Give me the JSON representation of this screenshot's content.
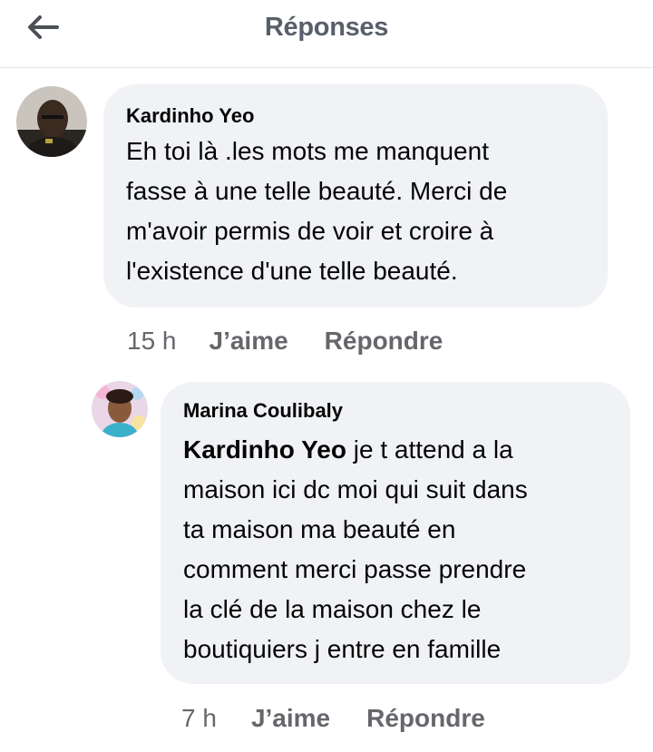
{
  "header": {
    "title": "Réponses",
    "back_icon": "arrow-left-icon"
  },
  "comments": [
    {
      "author": "Kardinho Yeo",
      "lines": [
        "Eh toi là .les mots me manquent",
        "fasse à une telle beauté. Merci de",
        "m'avoir permis de voir et croire à",
        "l'existence d'une telle beauté."
      ],
      "time": "15 h",
      "like_label": "J’aime",
      "reply_label": "Répondre"
    },
    {
      "author": "Marina Coulibaly",
      "mention": "Kardinho Yeo",
      "first_line_rest": " je t attend a la",
      "lines": [
        "maison ici dc moi qui suit dans",
        "ta maison ma beauté en",
        "comment merci passe prendre",
        "la clé de la maison chez le",
        "boutiquiers j entre en famille"
      ],
      "time": "7 h",
      "like_label": "J’aime",
      "reply_label": "Répondre"
    }
  ],
  "colors": {
    "bubble": "#f0f2f5",
    "text": "#050505",
    "meta": "#65676b",
    "divider": "#e4e6ea"
  }
}
